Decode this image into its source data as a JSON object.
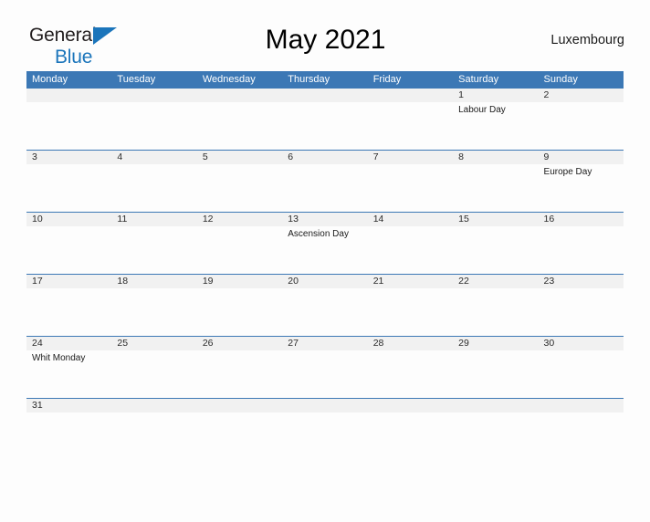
{
  "brand": {
    "line1": "General",
    "line2": "Blue",
    "flag_icon": "blue-triangle-flag-icon",
    "colors": {
      "dark": "#231f20",
      "blue": "#1b75bb"
    }
  },
  "header": {
    "title": "May 2021",
    "country": "Luxembourg"
  },
  "theme": {
    "header_blue": "#3c78b5",
    "row_divider_blue": "#3c78b5",
    "date_band_gray": "#f1f1f1",
    "page_background": "#fdfdfd"
  },
  "calendar": {
    "weekdays": [
      "Monday",
      "Tuesday",
      "Wednesday",
      "Thursday",
      "Friday",
      "Saturday",
      "Sunday"
    ],
    "weeks": [
      {
        "short": false,
        "days": [
          {
            "num": "",
            "event": ""
          },
          {
            "num": "",
            "event": ""
          },
          {
            "num": "",
            "event": ""
          },
          {
            "num": "",
            "event": ""
          },
          {
            "num": "",
            "event": ""
          },
          {
            "num": "1",
            "event": "Labour Day"
          },
          {
            "num": "2",
            "event": ""
          }
        ]
      },
      {
        "short": false,
        "days": [
          {
            "num": "3",
            "event": ""
          },
          {
            "num": "4",
            "event": ""
          },
          {
            "num": "5",
            "event": ""
          },
          {
            "num": "6",
            "event": ""
          },
          {
            "num": "7",
            "event": ""
          },
          {
            "num": "8",
            "event": ""
          },
          {
            "num": "9",
            "event": "Europe Day"
          }
        ]
      },
      {
        "short": false,
        "days": [
          {
            "num": "10",
            "event": ""
          },
          {
            "num": "11",
            "event": ""
          },
          {
            "num": "12",
            "event": ""
          },
          {
            "num": "13",
            "event": "Ascension Day"
          },
          {
            "num": "14",
            "event": ""
          },
          {
            "num": "15",
            "event": ""
          },
          {
            "num": "16",
            "event": ""
          }
        ]
      },
      {
        "short": false,
        "days": [
          {
            "num": "17",
            "event": ""
          },
          {
            "num": "18",
            "event": ""
          },
          {
            "num": "19",
            "event": ""
          },
          {
            "num": "20",
            "event": ""
          },
          {
            "num": "21",
            "event": ""
          },
          {
            "num": "22",
            "event": ""
          },
          {
            "num": "23",
            "event": ""
          }
        ]
      },
      {
        "short": false,
        "days": [
          {
            "num": "24",
            "event": "Whit Monday"
          },
          {
            "num": "25",
            "event": ""
          },
          {
            "num": "26",
            "event": ""
          },
          {
            "num": "27",
            "event": ""
          },
          {
            "num": "28",
            "event": ""
          },
          {
            "num": "29",
            "event": ""
          },
          {
            "num": "30",
            "event": ""
          }
        ]
      },
      {
        "short": true,
        "days": [
          {
            "num": "31",
            "event": ""
          },
          {
            "num": "",
            "event": ""
          },
          {
            "num": "",
            "event": ""
          },
          {
            "num": "",
            "event": ""
          },
          {
            "num": "",
            "event": ""
          },
          {
            "num": "",
            "event": ""
          },
          {
            "num": "",
            "event": ""
          }
        ]
      }
    ]
  }
}
